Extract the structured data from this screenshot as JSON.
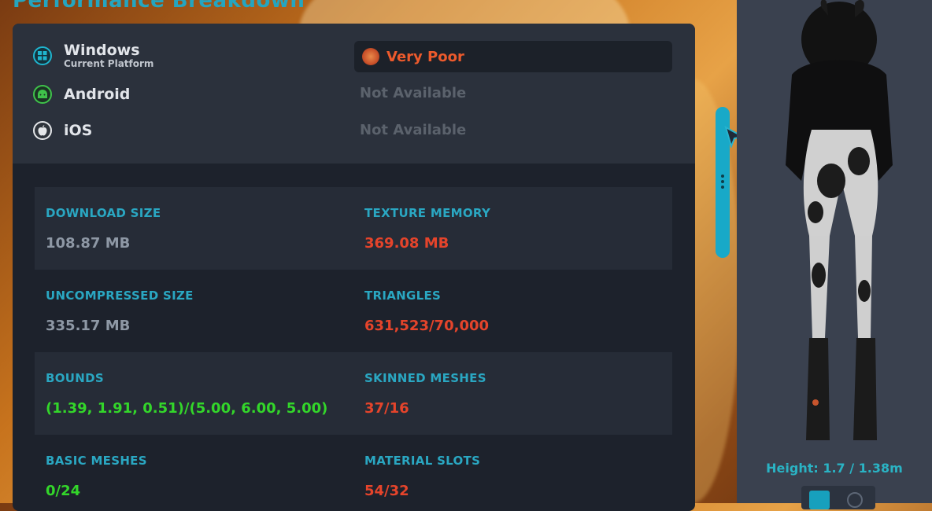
{
  "page": {
    "title": "Performance Breakdown"
  },
  "platforms": {
    "windows": {
      "name": "Windows",
      "sub": "Current Platform",
      "rating": "Very Poor",
      "icon": "windows-icon"
    },
    "android": {
      "name": "Android",
      "status": "Not Available",
      "icon": "android-icon"
    },
    "ios": {
      "name": "iOS",
      "status": "Not Available",
      "icon": "apple-icon"
    }
  },
  "stats": {
    "download_size": {
      "label": "DOWNLOAD SIZE",
      "value": "108.87 MB"
    },
    "texture_memory": {
      "label": "TEXTURE MEMORY",
      "value": "369.08 MB"
    },
    "uncompressed_size": {
      "label": "UNCOMPRESSED SIZE",
      "value": "335.17 MB"
    },
    "triangles": {
      "label": "TRIANGLES",
      "value": "631,523/70,000"
    },
    "bounds": {
      "label": "BOUNDS",
      "value": "(1.39, 1.91, 0.51)/(5.00, 6.00, 5.00)"
    },
    "skinned_meshes": {
      "label": "SKINNED MESHES",
      "value": "37/16"
    },
    "basic_meshes": {
      "label": "BASIC MESHES",
      "value": "0/24"
    },
    "material_slots": {
      "label": "MATERIAL SLOTS",
      "value": "54/32"
    }
  },
  "avatar": {
    "height_label": "Height: 1.7 / 1.38m"
  },
  "colors": {
    "accent": "#2aa7c2",
    "bad": "#e5442b",
    "good": "#33d62a",
    "neutral": "#8e98a5"
  }
}
